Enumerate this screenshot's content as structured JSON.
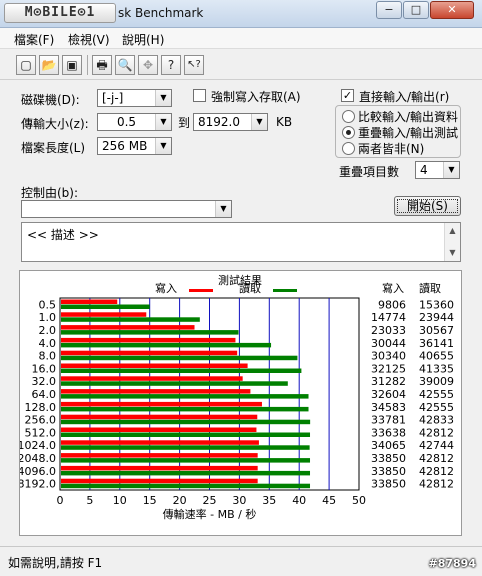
{
  "window": {
    "logo_text": "M⊙BILE⊙1",
    "title": "sk Benchmark",
    "minimize": "−",
    "maximize": "□",
    "close": "✕"
  },
  "menu": [
    {
      "label": "檔案(F)"
    },
    {
      "label": "檢視(V)"
    },
    {
      "label": "說明(H)"
    }
  ],
  "toolbar": {
    "icons": [
      "new-file-icon",
      "open-folder-icon",
      "save-disk-icon",
      "print-icon",
      "print-preview-icon",
      "move-icon",
      "help-question-icon",
      "context-help-icon"
    ],
    "glyphs": [
      "▢",
      "📂",
      "▣",
      "🖶",
      "🔍",
      "✥",
      "?",
      "↖?"
    ]
  },
  "form": {
    "drive_label": "磁碟機(D):",
    "drive_value": "[-j-]",
    "transfer_label": "傳輸大小(z):",
    "transfer_from": "0.5",
    "to_label": "到",
    "transfer_to": "8192.0",
    "unit": "KB",
    "filesize_label": "檔案長度(L)",
    "filesize_value": "256 MB",
    "force_write_label": "強制寫入存取(A)",
    "force_write_checked": false,
    "direct_io_label": "直接輸入/輸出(r)",
    "direct_io_checked": true,
    "radio_options": [
      {
        "label": "比較輸入/輸出資料",
        "selected": false
      },
      {
        "label": "重疊輸入/輸出測試",
        "selected": true
      },
      {
        "label": "兩者皆非(N)",
        "selected": false
      }
    ],
    "queue_label": "重疊項目數",
    "queue_value": "4",
    "control_label": "控制由(b):",
    "control_value": "",
    "start_button": "開始(S)",
    "description_text": "<<    描述    >>"
  },
  "chart_data": {
    "type": "bar",
    "title": "測試結果",
    "legend": [
      {
        "name": "寫入",
        "color": "#ff0000"
      },
      {
        "name": "讀取",
        "color": "#008000"
      }
    ],
    "col_header_write": "寫入",
    "col_header_read": "讀取",
    "categories": [
      "0.5",
      "1.0",
      "2.0",
      "4.0",
      "8.0",
      "16.0",
      "32.0",
      "64.0",
      "128.0",
      "256.0",
      "512.0",
      "1024.0",
      "2048.0",
      "4096.0",
      "8192.0"
    ],
    "write": [
      9806,
      14774,
      23033,
      30044,
      30340,
      32125,
      31282,
      32604,
      34583,
      33781,
      33638,
      34065,
      33850,
      33850,
      33850
    ],
    "read": [
      15360,
      23944,
      30567,
      36141,
      40655,
      41335,
      39009,
      42555,
      42555,
      42833,
      42812,
      42744,
      42812,
      42812,
      42812
    ],
    "x_ticks": [
      0,
      5,
      10,
      15,
      20,
      25,
      30,
      35,
      40,
      45,
      50
    ],
    "xlim": [
      0,
      50
    ],
    "xlabel": "傳輸速率 - MB / 秒",
    "grid": true
  },
  "status": {
    "help_text": "如需說明,請按 F1",
    "watermark": "#87894"
  }
}
